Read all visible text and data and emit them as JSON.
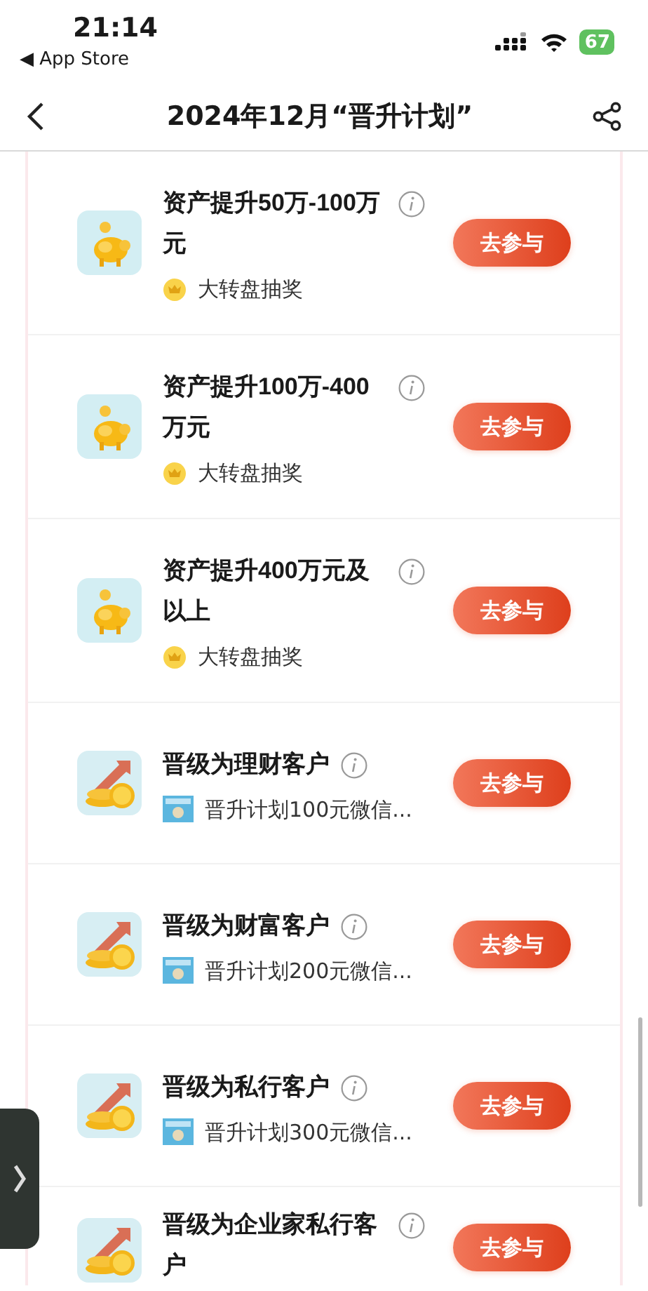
{
  "status_bar": {
    "time": "21:14",
    "back_app": "◀ App Store",
    "battery": "67"
  },
  "nav": {
    "title": "2024年12月“晋升计划”"
  },
  "tasks": [
    {
      "title": "资产提升50万-100万元",
      "kind": "piggy",
      "reward": {
        "kind": "lottery",
        "text": "大转盘抽奖"
      },
      "button": "去参与"
    },
    {
      "title": "资产提升100万-400万元",
      "kind": "piggy",
      "reward": {
        "kind": "lottery",
        "text": "大转盘抽奖"
      },
      "button": "去参与"
    },
    {
      "title": "资产提升400万元及以上",
      "kind": "piggy",
      "reward": {
        "kind": "lottery",
        "text": "大转盘抽奖"
      },
      "button": "去参与"
    },
    {
      "title": "晋级为理财客户",
      "kind": "coins",
      "reward": {
        "kind": "voucher",
        "text": "晋升计划100元微信..."
      },
      "button": "去参与"
    },
    {
      "title": "晋级为财富客户",
      "kind": "coins",
      "reward": {
        "kind": "voucher",
        "text": "晋升计划200元微信..."
      },
      "button": "去参与"
    },
    {
      "title": "晋级为私行客户",
      "kind": "coins",
      "reward": {
        "kind": "voucher",
        "text": "晋升计划300元微信..."
      },
      "button": "去参与"
    },
    {
      "title": "晋级为企业家私行客户",
      "kind": "coins",
      "button": "去参与"
    }
  ]
}
